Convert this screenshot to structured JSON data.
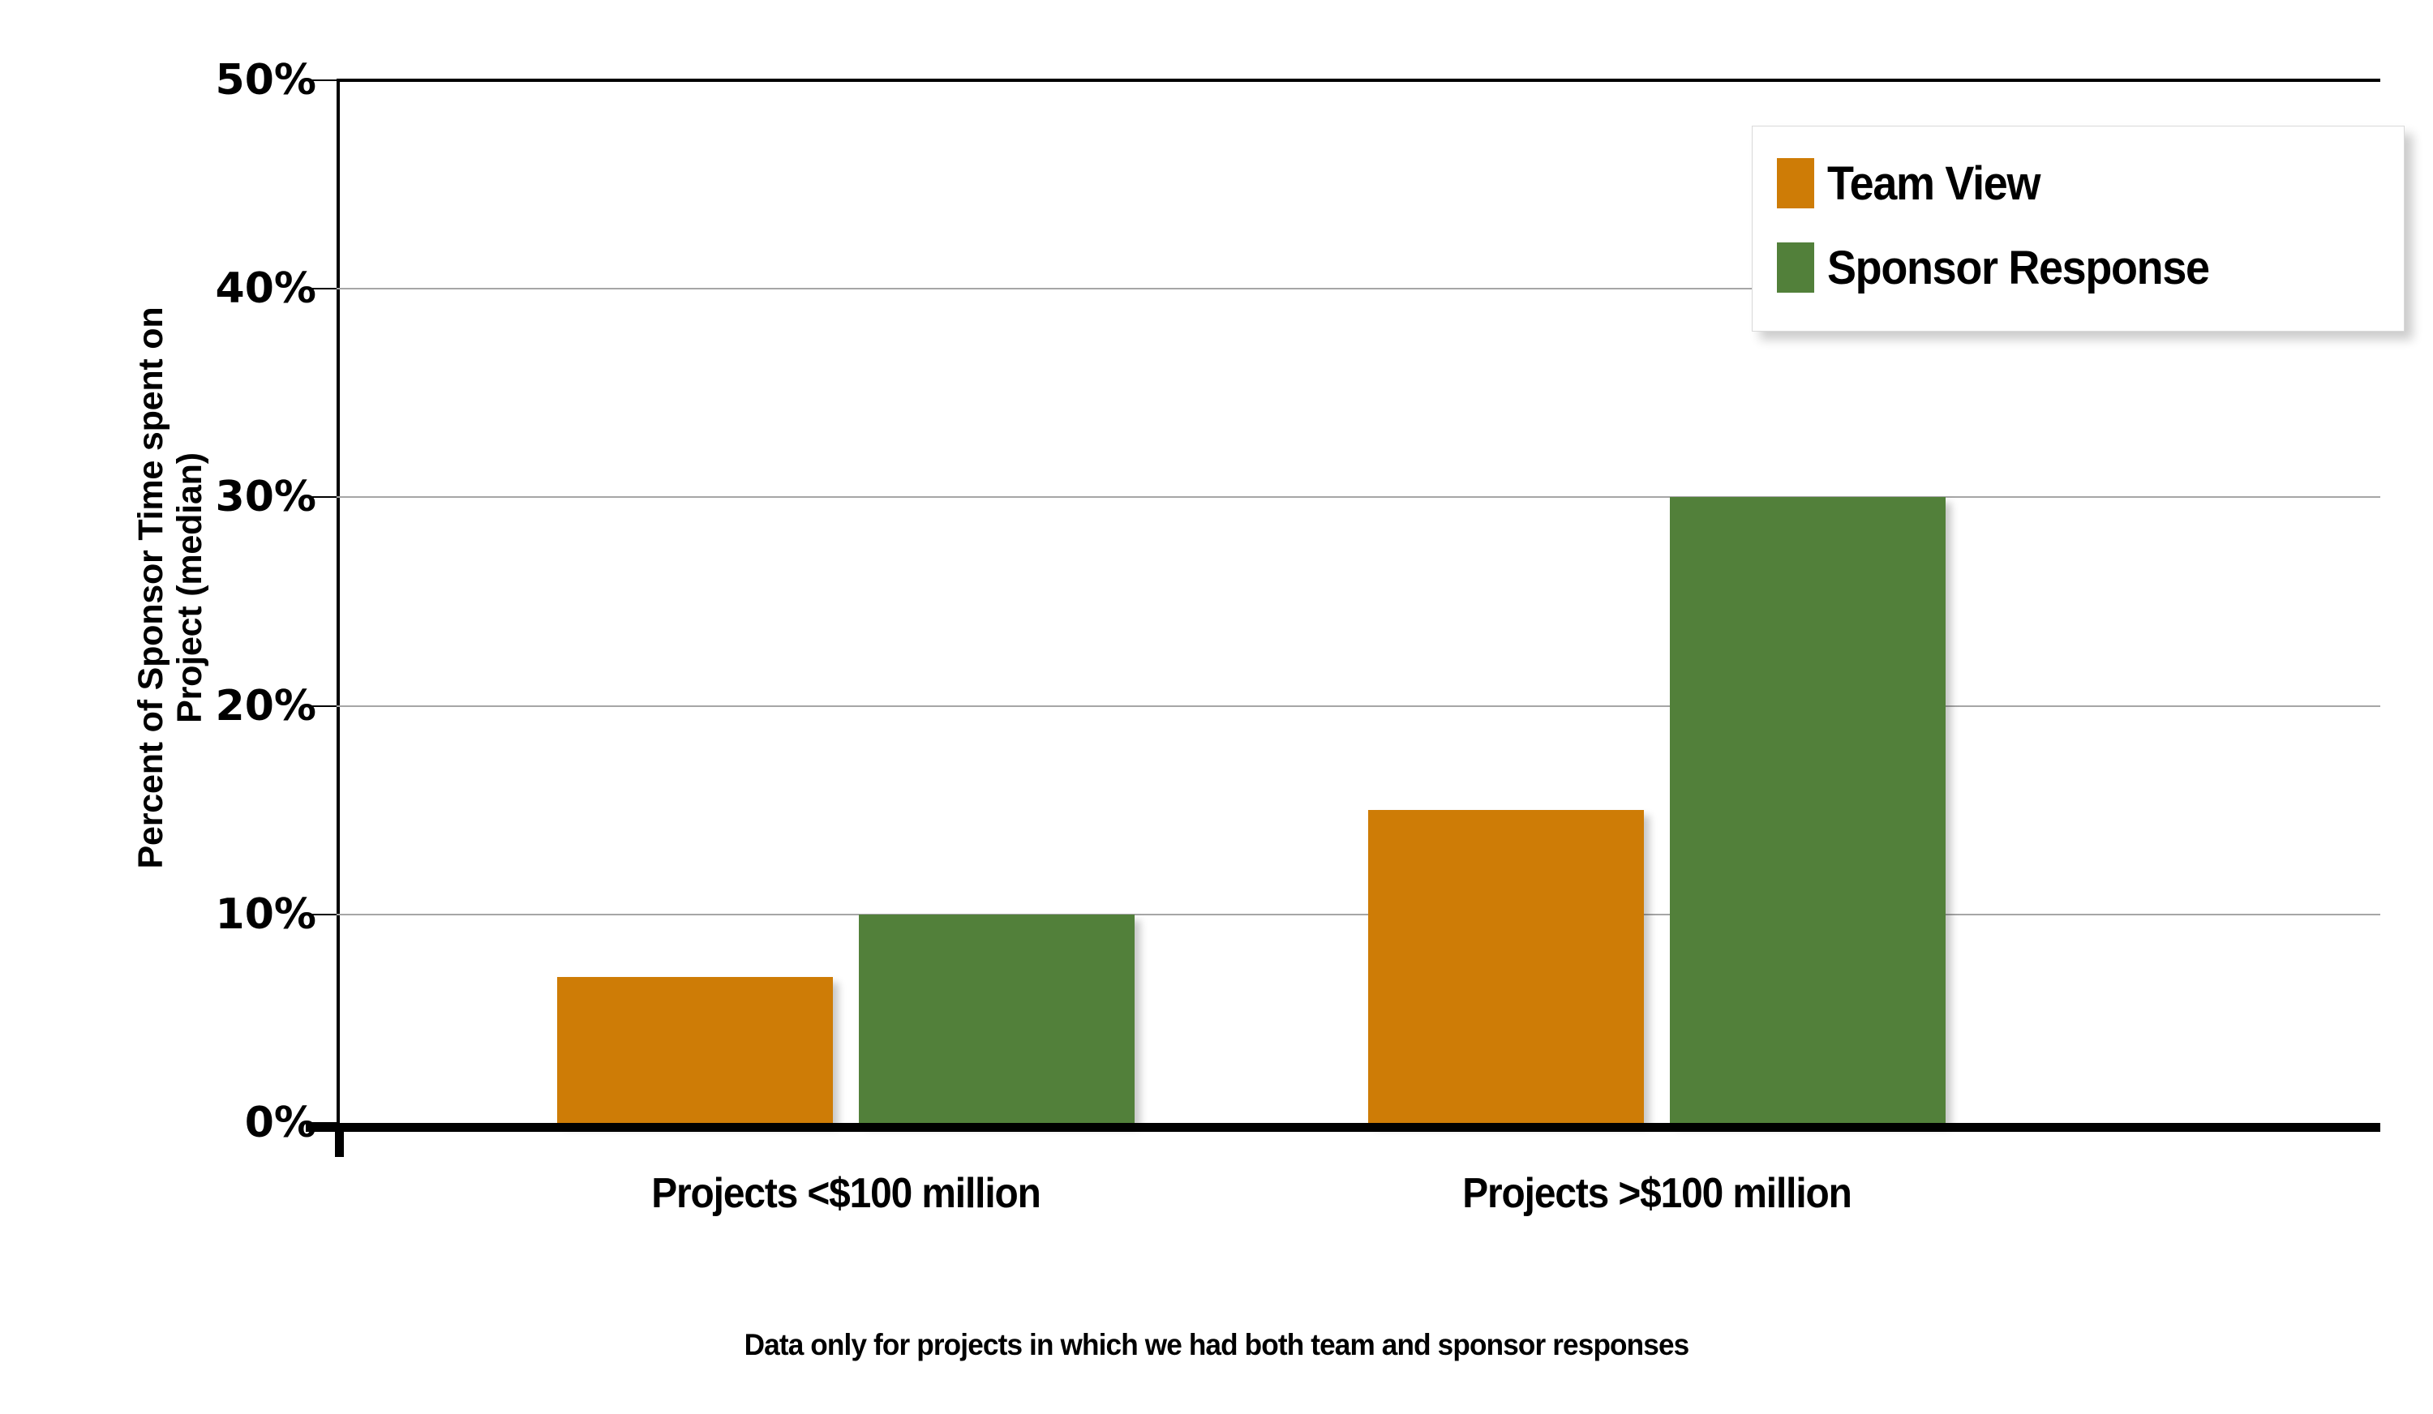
{
  "chart_data": {
    "type": "bar",
    "title": "",
    "xlabel": "",
    "ylabel": "Percent of Sponsor Time spent on Project (median)",
    "ylabel_lines": [
      "Percent of Sponsor Time spent on",
      "Project (median)"
    ],
    "categories": [
      "Projects <$100 million",
      "Projects >$100 million"
    ],
    "series": [
      {
        "name": "Team View",
        "color": "#CE7C06",
        "values": [
          7,
          15
        ]
      },
      {
        "name": "Sponsor Response",
        "color": "#52803A",
        "values": [
          10,
          30
        ]
      }
    ],
    "ylim": [
      0,
      50
    ],
    "ytick_values": [
      0,
      10,
      20,
      30,
      40,
      50
    ],
    "ytick_labels": [
      "0%",
      "10%",
      "20%",
      "30%",
      "40%",
      "50%"
    ],
    "value_unit": "%",
    "grid": true,
    "legend_position": "top-right",
    "annotation": "Data only for projects in which we had both team and sponsor responses"
  },
  "legend": {
    "items": [
      {
        "label": "Team View",
        "color": "#CE7C06"
      },
      {
        "label": "Sponsor Response",
        "color": "#52803A"
      }
    ]
  },
  "axis": {
    "y_title_line1": "Percent of Sponsor Time spent on",
    "y_title_line2": "Project (median)",
    "y_labels": [
      "50%",
      "40%",
      "30%",
      "20%",
      "10%",
      "0%"
    ]
  },
  "categories": [
    "Projects <$100 million",
    "Projects >$100 million"
  ],
  "footnote": "Data only for projects in which we had both team and sponsor responses",
  "colors": {
    "team_view": "#CE7C06",
    "sponsor_response": "#52803A",
    "gridline": "#A6A6A6",
    "axis": "#000000",
    "background": "#FFFFFF"
  }
}
